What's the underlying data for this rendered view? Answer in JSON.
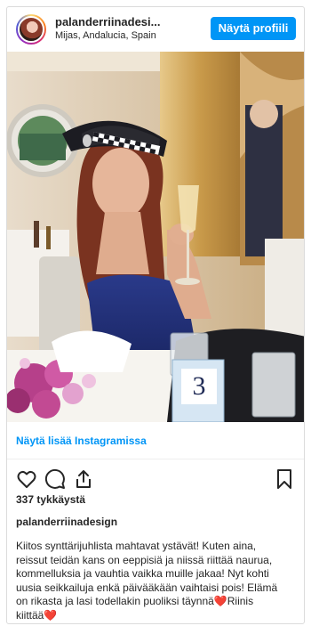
{
  "header": {
    "username": "palanderriinadesi...",
    "location": "Mijas, Andalucia, Spain",
    "profile_button": "Näytä profiili"
  },
  "photo": {
    "table_number": "3"
  },
  "view_more_link": "Näytä lisää Instagramissa",
  "actions": {
    "icons": [
      "heart-icon",
      "comment-icon",
      "share-icon",
      "bookmark-icon"
    ]
  },
  "likes": "337 tykkäystä",
  "owner": "palanderriinadesign",
  "caption": {
    "lines": [
      "Kiitos synttärijuhlista mahtavat ystävät! Kuten aina,",
      "reissut teidän kans on eeppisiä ja niissä riittää naurua,",
      "kommelluksia ja vauhtia vaikka muille jakaa! Nyt kohti",
      "uusia seikkailuja enkä päivääkään vaihtaisi pois! Elämä",
      "on rikasta ja lasi todellakin puoliksi täynnä❤️Riinis",
      "kiittää❤️"
    ]
  },
  "colors": {
    "accent": "#0095f6",
    "text": "#262626",
    "border": "#dbdbdb"
  }
}
